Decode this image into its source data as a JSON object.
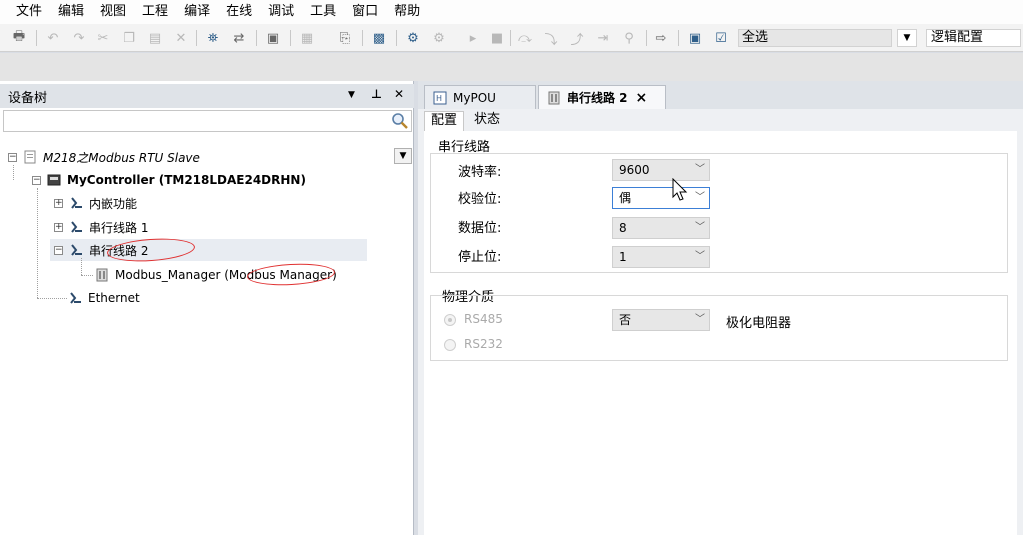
{
  "menu": [
    "文件",
    "编辑",
    "视图",
    "工程",
    "编译",
    "在线",
    "调试",
    "工具",
    "窗口",
    "帮助"
  ],
  "toolbar": {
    "selection_combo": "全选",
    "config_combo": "逻辑配置"
  },
  "device_tree": {
    "title": "设备树",
    "search_placeholder": "",
    "project": "M218之Modbus RTU Slave",
    "controller": "MyController (TM218LDAE24DRHN)",
    "items": [
      "内嵌功能",
      "串行线路 1",
      "串行线路 2"
    ],
    "manager": "Modbus_Manager (Modbus Manager)",
    "ethernet": "Ethernet"
  },
  "editor": {
    "tabs": [
      {
        "label": "MyPOU"
      },
      {
        "label": "串行线路 2",
        "close": "×"
      }
    ],
    "subtabs": [
      "配置",
      "状态"
    ],
    "serial_group": {
      "title": "串行线路",
      "fields": [
        {
          "label": "波特率:",
          "value": "9600"
        },
        {
          "label": "校验位:",
          "value": "偶"
        },
        {
          "label": "数据位:",
          "value": "8"
        },
        {
          "label": "停止位:",
          "value": "1"
        }
      ]
    },
    "physical_group": {
      "title": "物理介质",
      "rs485": "RS485",
      "rs232": "RS232",
      "polarization_value": "否",
      "polarization_label": "极化电阻器"
    }
  },
  "colors": {
    "annotation": "#e03030",
    "focus_border": "#3c7fd6",
    "panel_header": "#dfe3e8"
  }
}
